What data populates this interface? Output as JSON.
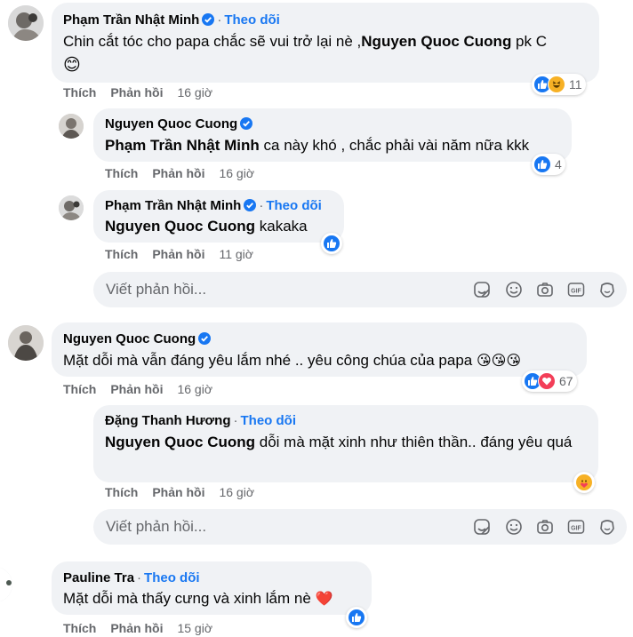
{
  "comments": [
    {
      "author": "Phạm Trần Nhật Minh",
      "follow": "Theo dõi",
      "mention": "Nguyen Quoc Cuong",
      "text_before": "Chin cắt tóc cho papa chắc sẽ vui trở lại nè ,",
      "text_after": " pk C",
      "emoji": "😊",
      "like_label": "Thích",
      "reply_label": "Phản hồi",
      "time": "16 giờ",
      "reactions_count": "11"
    },
    {
      "author": "Nguyen Quoc Cuong",
      "mention": "Phạm Trần Nhật Minh",
      "text": " ca này khó , chắc phải vài năm nữa kkk",
      "like_label": "Thích",
      "reply_label": "Phản hồi",
      "time": "16 giờ",
      "reactions_count": "4"
    },
    {
      "author": "Phạm Trần Nhật Minh",
      "follow": "Theo dõi",
      "mention": "Nguyen Quoc Cuong",
      "text": " kakaka",
      "like_label": "Thích",
      "reply_label": "Phản hồi",
      "time": "11 giờ"
    },
    {
      "author": "Nguyen Quoc Cuong",
      "text": "Mặt dỗi mà vẫn đáng yêu lắm nhé .. yêu công chúa của papa",
      "emoji": "😘😘😘",
      "like_label": "Thích",
      "reply_label": "Phản hồi",
      "time": "16 giờ",
      "reactions_count": "67"
    },
    {
      "author": "Đặng Thanh Hương",
      "follow": "Theo dõi",
      "mention": "Nguyen Quoc Cuong",
      "text": " dỗi mà mặt xinh như thiên thần.. đáng yêu quá",
      "like_label": "Thích",
      "reply_label": "Phản hồi",
      "time": "16 giờ"
    },
    {
      "author": "Pauline Tra",
      "follow": "Theo dõi",
      "text": "Mặt dỗi mà thấy cưng và xinh lắm nè",
      "emoji": "❤️",
      "like_label": "Thích",
      "reply_label": "Phản hồi",
      "time": "15 giờ"
    }
  ],
  "reply_box": {
    "placeholder": "Viết phản hồi..."
  },
  "colors": {
    "bubble": "#f0f2f5",
    "link": "#1877f2",
    "muted": "#65676b",
    "like": "#1877f2",
    "love": "#f33e58",
    "haha": "#f7b125"
  },
  "icons": [
    "verified-icon",
    "like-icon",
    "haha-icon",
    "love-icon",
    "care-icon",
    "sticker-icon",
    "emoji-icon",
    "camera-icon",
    "gif-icon",
    "avatar-sticker-icon"
  ]
}
